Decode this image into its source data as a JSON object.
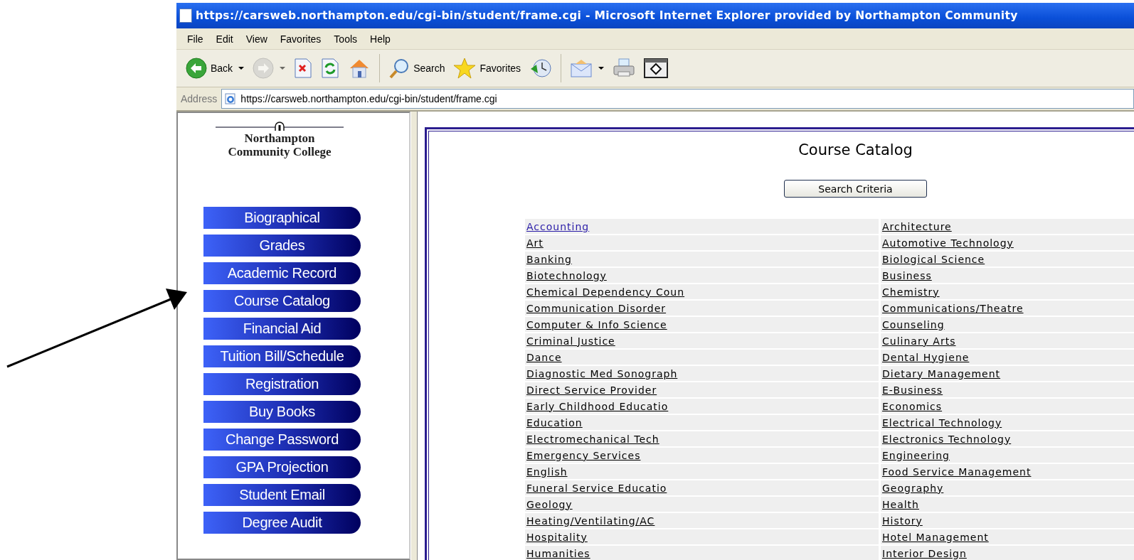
{
  "window": {
    "title": "https://carsweb.northampton.edu/cgi-bin/student/frame.cgi - Microsoft Internet Explorer provided by Northampton Community"
  },
  "menu": [
    "File",
    "Edit",
    "View",
    "Favorites",
    "Tools",
    "Help"
  ],
  "toolbar": [
    {
      "kind": "back",
      "label": "Back",
      "dropdown": true,
      "disabled": false
    },
    {
      "kind": "forward",
      "dropdown": true,
      "disabled": true
    },
    {
      "kind": "stop",
      "dropdown": false,
      "disabled": false
    },
    {
      "kind": "refresh",
      "dropdown": false,
      "disabled": false
    },
    {
      "kind": "home",
      "dropdown": false,
      "disabled": false
    },
    {
      "kind": "separator"
    },
    {
      "kind": "search",
      "label": "Search",
      "dropdown": false,
      "disabled": false
    },
    {
      "kind": "favorites",
      "label": "Favorites",
      "dropdown": false,
      "disabled": false
    },
    {
      "kind": "history",
      "dropdown": false,
      "disabled": false
    },
    {
      "kind": "separator"
    },
    {
      "kind": "mail",
      "dropdown": true,
      "disabled": false
    },
    {
      "kind": "print",
      "dropdown": false,
      "disabled": false
    },
    {
      "kind": "edit",
      "dropdown": false,
      "disabled": false
    }
  ],
  "address": {
    "label": "Address",
    "value": "https://carsweb.northampton.edu/cgi-bin/student/frame.cgi"
  },
  "sidebar": {
    "logo": [
      "Northampton",
      "Community College"
    ],
    "buttons": [
      "Biographical",
      "Grades",
      "Academic Record",
      "Course Catalog",
      "Financial Aid",
      "Tuition Bill/Schedule",
      "Registration",
      "Buy Books",
      "Change Password",
      "GPA Projection",
      "Student Email",
      "Degree Audit"
    ]
  },
  "content": {
    "heading": "Course Catalog",
    "search_button": "Search Criteria",
    "courses": [
      {
        "text": "Accounting",
        "visited": false
      },
      {
        "text": "Architecture",
        "visited": true
      },
      {
        "text": "Art",
        "visited": true
      },
      {
        "text": "Automotive Technology",
        "visited": true
      },
      {
        "text": "Banking",
        "visited": true
      },
      {
        "text": "Biological Science",
        "visited": true
      },
      {
        "text": "Biotechnology",
        "visited": true
      },
      {
        "text": "Business",
        "visited": true
      },
      {
        "text": "Chemical Dependency Coun",
        "visited": true
      },
      {
        "text": "Chemistry",
        "visited": true
      },
      {
        "text": "Communication Disorder",
        "visited": true
      },
      {
        "text": "Communications/Theatre",
        "visited": true
      },
      {
        "text": "Computer & Info Science",
        "visited": true
      },
      {
        "text": "Counseling",
        "visited": true
      },
      {
        "text": "Criminal Justice",
        "visited": true
      },
      {
        "text": "Culinary Arts",
        "visited": true
      },
      {
        "text": "Dance",
        "visited": true
      },
      {
        "text": "Dental Hygiene",
        "visited": true
      },
      {
        "text": "Diagnostic Med Sonograph",
        "visited": true
      },
      {
        "text": "Dietary Management",
        "visited": true
      },
      {
        "text": "Direct Service Provider",
        "visited": true
      },
      {
        "text": "E-Business",
        "visited": true
      },
      {
        "text": "Early Childhood Educatio",
        "visited": true
      },
      {
        "text": "Economics",
        "visited": true
      },
      {
        "text": "Education",
        "visited": true
      },
      {
        "text": "Electrical Technology",
        "visited": true
      },
      {
        "text": "Electromechanical Tech",
        "visited": true
      },
      {
        "text": "Electronics Technology",
        "visited": true
      },
      {
        "text": "Emergency Services",
        "visited": true
      },
      {
        "text": "Engineering",
        "visited": true
      },
      {
        "text": "English",
        "visited": true
      },
      {
        "text": "Food Service Management",
        "visited": true
      },
      {
        "text": "Funeral Service Educatio",
        "visited": true
      },
      {
        "text": "Geography",
        "visited": true
      },
      {
        "text": "Geology",
        "visited": true
      },
      {
        "text": "Health",
        "visited": true
      },
      {
        "text": "Heating/Ventilating/AC",
        "visited": true
      },
      {
        "text": "History",
        "visited": true
      },
      {
        "text": "Hospitality",
        "visited": true
      },
      {
        "text": "Hotel Management",
        "visited": true
      },
      {
        "text": "Humanities",
        "visited": true
      },
      {
        "text": "Interior Design",
        "visited": true
      }
    ]
  }
}
